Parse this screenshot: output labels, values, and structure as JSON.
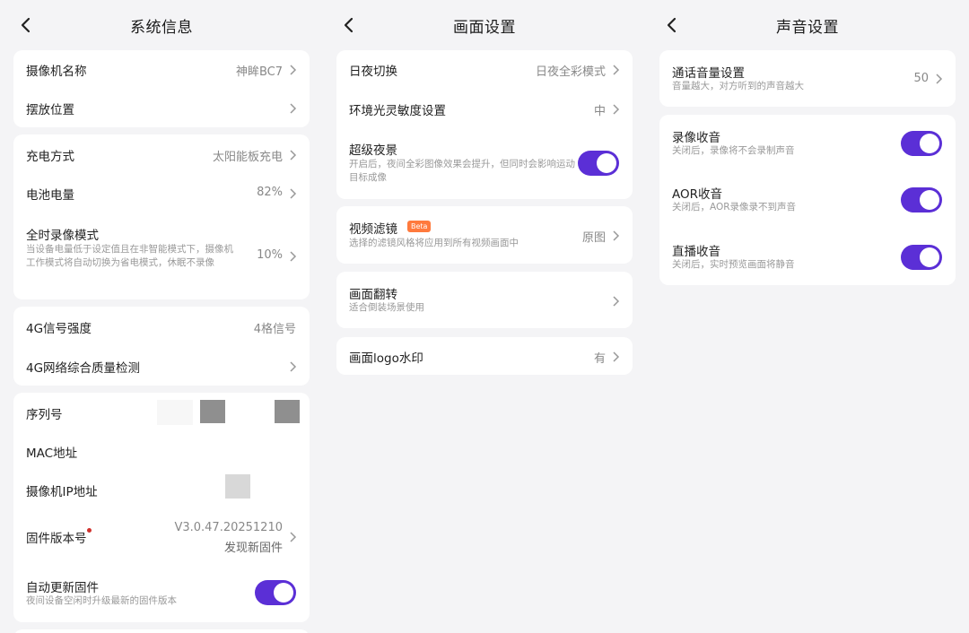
{
  "panels": {
    "system": {
      "title": "系统信息",
      "rows": {
        "camera_name": {
          "label": "摄像机名称",
          "value": "神眸BC7"
        },
        "position": {
          "label": "摆放位置"
        },
        "charging": {
          "label": "充电方式",
          "value": "太阳能板充电"
        },
        "battery": {
          "label": "电池电量",
          "value": "82%"
        },
        "full_record": {
          "label": "全时录像模式",
          "sub": "当设备电量低于设定值且在非智能模式下，摄像机工作模式将自动切换为省电模式，休眠不录像",
          "value": "10%"
        },
        "signal": {
          "label": "4G信号强度",
          "value": "4格信号"
        },
        "net_check": {
          "label": "4G网络综合质量检测"
        },
        "serial": {
          "label": "序列号"
        },
        "mac": {
          "label": "MAC地址"
        },
        "ip": {
          "label": "摄像机IP地址"
        },
        "firmware": {
          "label": "固件版本号",
          "value": "V3.0.47.20251210",
          "value2": "发现新固件"
        },
        "auto_update": {
          "label": "自动更新固件",
          "sub": "夜间设备空闲时升级最新的固件版本",
          "on": true
        }
      }
    },
    "picture": {
      "title": "画面设置",
      "rows": {
        "day_night": {
          "label": "日夜切换",
          "value": "日夜全彩模式"
        },
        "light_sens": {
          "label": "环境光灵敏度设置",
          "value": "中"
        },
        "super_night": {
          "label": "超级夜景",
          "sub": "开启后，夜间全彩图像效果会提升，但同时会影响运动目标成像",
          "on": true
        },
        "filter": {
          "label": "视频滤镜",
          "badge": "Beta",
          "sub": "选择的滤镜风格将应用到所有视频画面中",
          "value": "原图"
        },
        "flip": {
          "label": "画面翻转",
          "sub": "适合倒装场景使用"
        },
        "logo": {
          "label": "画面logo水印",
          "value": "有"
        }
      }
    },
    "sound": {
      "title": "声音设置",
      "rows": {
        "call_volume": {
          "label": "通话音量设置",
          "sub": "音量越大，对方听到的声音越大",
          "value": "50"
        },
        "rec_audio": {
          "label": "录像收音",
          "sub": "关闭后，录像将不会录制声音",
          "on": true
        },
        "aor_audio": {
          "label": "AOR收音",
          "sub": "关闭后，AOR录像录不到声音",
          "on": true
        },
        "live_audio": {
          "label": "直播收音",
          "sub": "关闭后，实时预览画面将静音",
          "on": true
        }
      }
    }
  },
  "colors": {
    "accent": "#5b2fd6",
    "background": "#f4f4f6",
    "card": "#ffffff",
    "beta": "#ff7a3d",
    "dot": "#d0312d"
  }
}
